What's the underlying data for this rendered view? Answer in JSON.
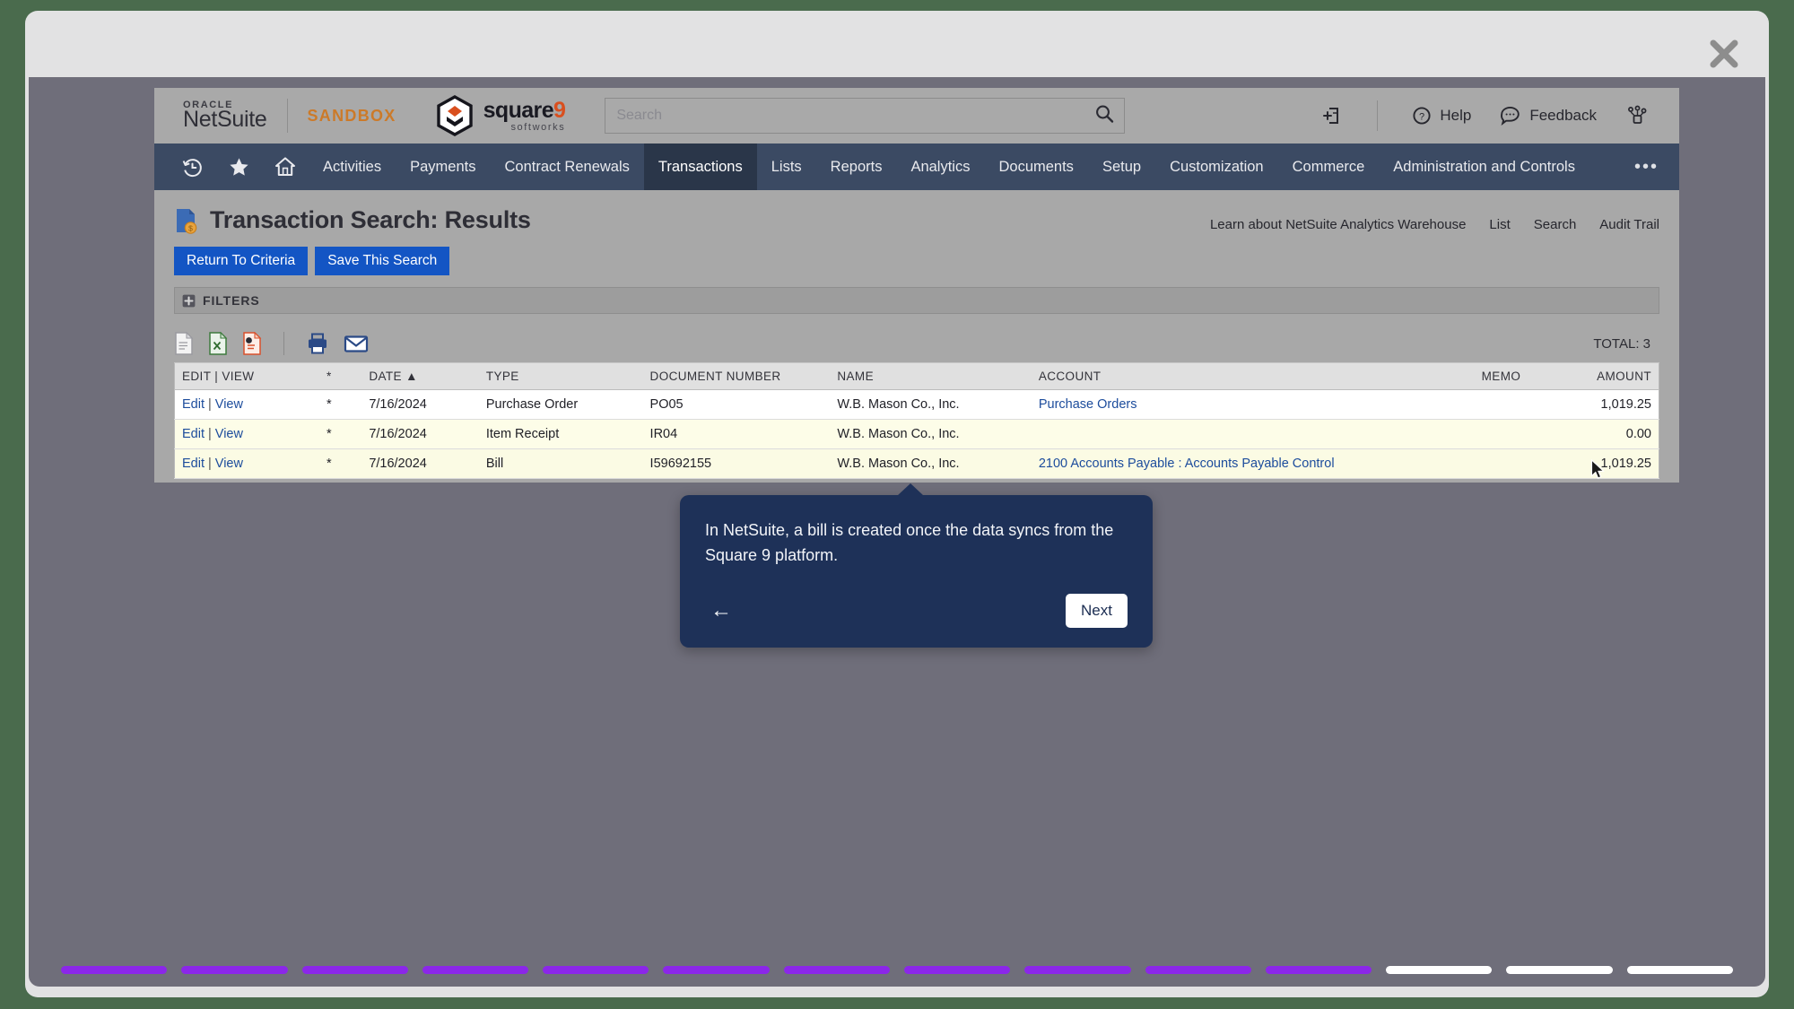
{
  "modal": {
    "close_icon": "close-icon"
  },
  "header": {
    "oracle_word": "ORACLE",
    "netsuite_word": "NetSuite",
    "sandbox_label": "SANDBOX",
    "square9_main": "square",
    "square9_nine": "9",
    "square9_sub": "softworks",
    "search": {
      "value": "",
      "placeholder": "Search",
      "icon": "search-icon"
    },
    "new_tab_icon": "open-new-window-icon",
    "help": {
      "label": "Help",
      "icon": "question-circle-icon"
    },
    "feedback": {
      "label": "Feedback",
      "icon": "chat-bubble-icon"
    },
    "groups_icon": "user-group-icon"
  },
  "nav": {
    "recent_icon": "recent-history-icon",
    "favorites_icon": "star-icon",
    "home_icon": "home-icon",
    "items": [
      {
        "label": "Activities",
        "active": false
      },
      {
        "label": "Payments",
        "active": false
      },
      {
        "label": "Contract Renewals",
        "active": false
      },
      {
        "label": "Transactions",
        "active": true
      },
      {
        "label": "Lists",
        "active": false
      },
      {
        "label": "Reports",
        "active": false
      },
      {
        "label": "Analytics",
        "active": false
      },
      {
        "label": "Documents",
        "active": false
      },
      {
        "label": "Setup",
        "active": false
      },
      {
        "label": "Customization",
        "active": false
      },
      {
        "label": "Commerce",
        "active": false
      },
      {
        "label": "Administration and Controls",
        "active": false
      }
    ],
    "more_label": "•••"
  },
  "page": {
    "title": "Transaction Search: Results",
    "title_icon": "transaction-search-icon",
    "buttons": [
      {
        "label": "Return To Criteria"
      },
      {
        "label": "Save This Search"
      }
    ],
    "links": [
      {
        "label": "Learn about NetSuite Analytics Warehouse"
      },
      {
        "label": "List"
      },
      {
        "label": "Search"
      },
      {
        "label": "Audit Trail"
      }
    ],
    "filters_label": "FILTERS",
    "filters_icon": "plus-box-icon",
    "toolbar_icons": [
      {
        "name": "export-csv-icon"
      },
      {
        "name": "export-excel-icon"
      },
      {
        "name": "export-pdf-icon"
      },
      {
        "name": "print-icon"
      },
      {
        "name": "email-icon"
      }
    ],
    "total_label": "TOTAL: 3"
  },
  "table": {
    "columns": [
      {
        "label": "EDIT | VIEW",
        "align": "left"
      },
      {
        "label": "*",
        "align": "center"
      },
      {
        "label": "DATE ▲",
        "align": "left"
      },
      {
        "label": "TYPE",
        "align": "left"
      },
      {
        "label": "DOCUMENT NUMBER",
        "align": "left"
      },
      {
        "label": "NAME",
        "align": "left"
      },
      {
        "label": "ACCOUNT",
        "align": "left"
      },
      {
        "label": "MEMO",
        "align": "right"
      },
      {
        "label": "AMOUNT",
        "align": "right"
      }
    ],
    "rows": [
      {
        "edit": "Edit",
        "view": "View",
        "star": "*",
        "date": "7/16/2024",
        "type": "Purchase Order",
        "document_number": "PO05",
        "name": "W.B. Mason Co., Inc.",
        "account": "Purchase Orders",
        "account_is_link": true,
        "memo": "",
        "amount": "1,019.25"
      },
      {
        "edit": "Edit",
        "view": "View",
        "star": "*",
        "date": "7/16/2024",
        "type": "Item Receipt",
        "document_number": "IR04",
        "name": "W.B. Mason Co., Inc.",
        "account": "",
        "account_is_link": false,
        "memo": "",
        "amount": "0.00"
      },
      {
        "edit": "Edit",
        "view": "View",
        "star": "*",
        "date": "7/16/2024",
        "type": "Bill",
        "document_number": "I59692155",
        "name": "W.B. Mason Co., Inc.",
        "account": "2100 Accounts Payable : Accounts Payable Control",
        "account_is_link": true,
        "memo": "",
        "amount": "1,019.25"
      }
    ]
  },
  "coachmark": {
    "text": "In NetSuite, a bill is created once the data syncs from the Square 9 platform.",
    "back_label": "←",
    "next_label": "Next"
  },
  "progress": {
    "total": 14,
    "completed": 11
  },
  "colors": {
    "accent_blue": "#1355c4",
    "nav_bg": "#3b4a63",
    "nav_active": "#2a3649",
    "sandbox_orange": "#cc7a29",
    "square9_orange": "#d94f1e",
    "coachmark_bg": "#1e3158",
    "progress_done": "#8b27e8",
    "link_blue": "#1c4c9c"
  }
}
